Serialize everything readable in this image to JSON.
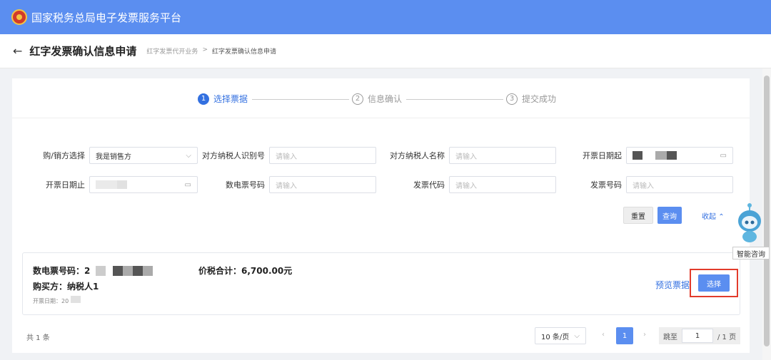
{
  "header": {
    "title": "国家税务总局电子发票服务平台"
  },
  "subheader": {
    "page_title": "红字发票确认信息申请",
    "breadcrumb": [
      "红字发票代开业务",
      "红字发票确认信息申请"
    ],
    "breadcrumb_sep": ">"
  },
  "steps": [
    {
      "num": "1",
      "label": "选择票据"
    },
    {
      "num": "2",
      "label": "信息确认"
    },
    {
      "num": "3",
      "label": "提交成功"
    }
  ],
  "form": {
    "buyer_seller_label": "购/销方选择",
    "buyer_seller_value": "我是销售方",
    "counterparty_id_label": "对方纳税人识别号",
    "counterparty_name_label": "对方纳税人名称",
    "date_start_label": "开票日期起",
    "date_end_label": "开票日期止",
    "e_invoice_no_label": "数电票号码",
    "invoice_code_label": "发票代码",
    "invoice_no_label": "发票号码",
    "placeholder": "请输入"
  },
  "actions": {
    "reset": "重置",
    "query": "查询",
    "collapse": "收起"
  },
  "result": {
    "e_invoice_no_label": "数电票号码：",
    "e_invoice_no_partial": "2",
    "total_label": "价税合计：",
    "total_value": "6,700.00元",
    "buyer_label": "购买方：",
    "buyer_value": "纳税人1",
    "date_label": "开票日期：",
    "date_partial": "20",
    "preview": "预览票据",
    "select": "选择"
  },
  "pager": {
    "total": "共 1 条",
    "page_size": "10 条/页",
    "current": "1",
    "jump_label": "跳至",
    "jump_value": "1",
    "page_total": "/ 1 页"
  },
  "assistant": {
    "label": "智能咨询"
  },
  "colors": {
    "primary": "#5b8ef0",
    "highlight": "#e23b2b",
    "link": "#3370e0"
  }
}
